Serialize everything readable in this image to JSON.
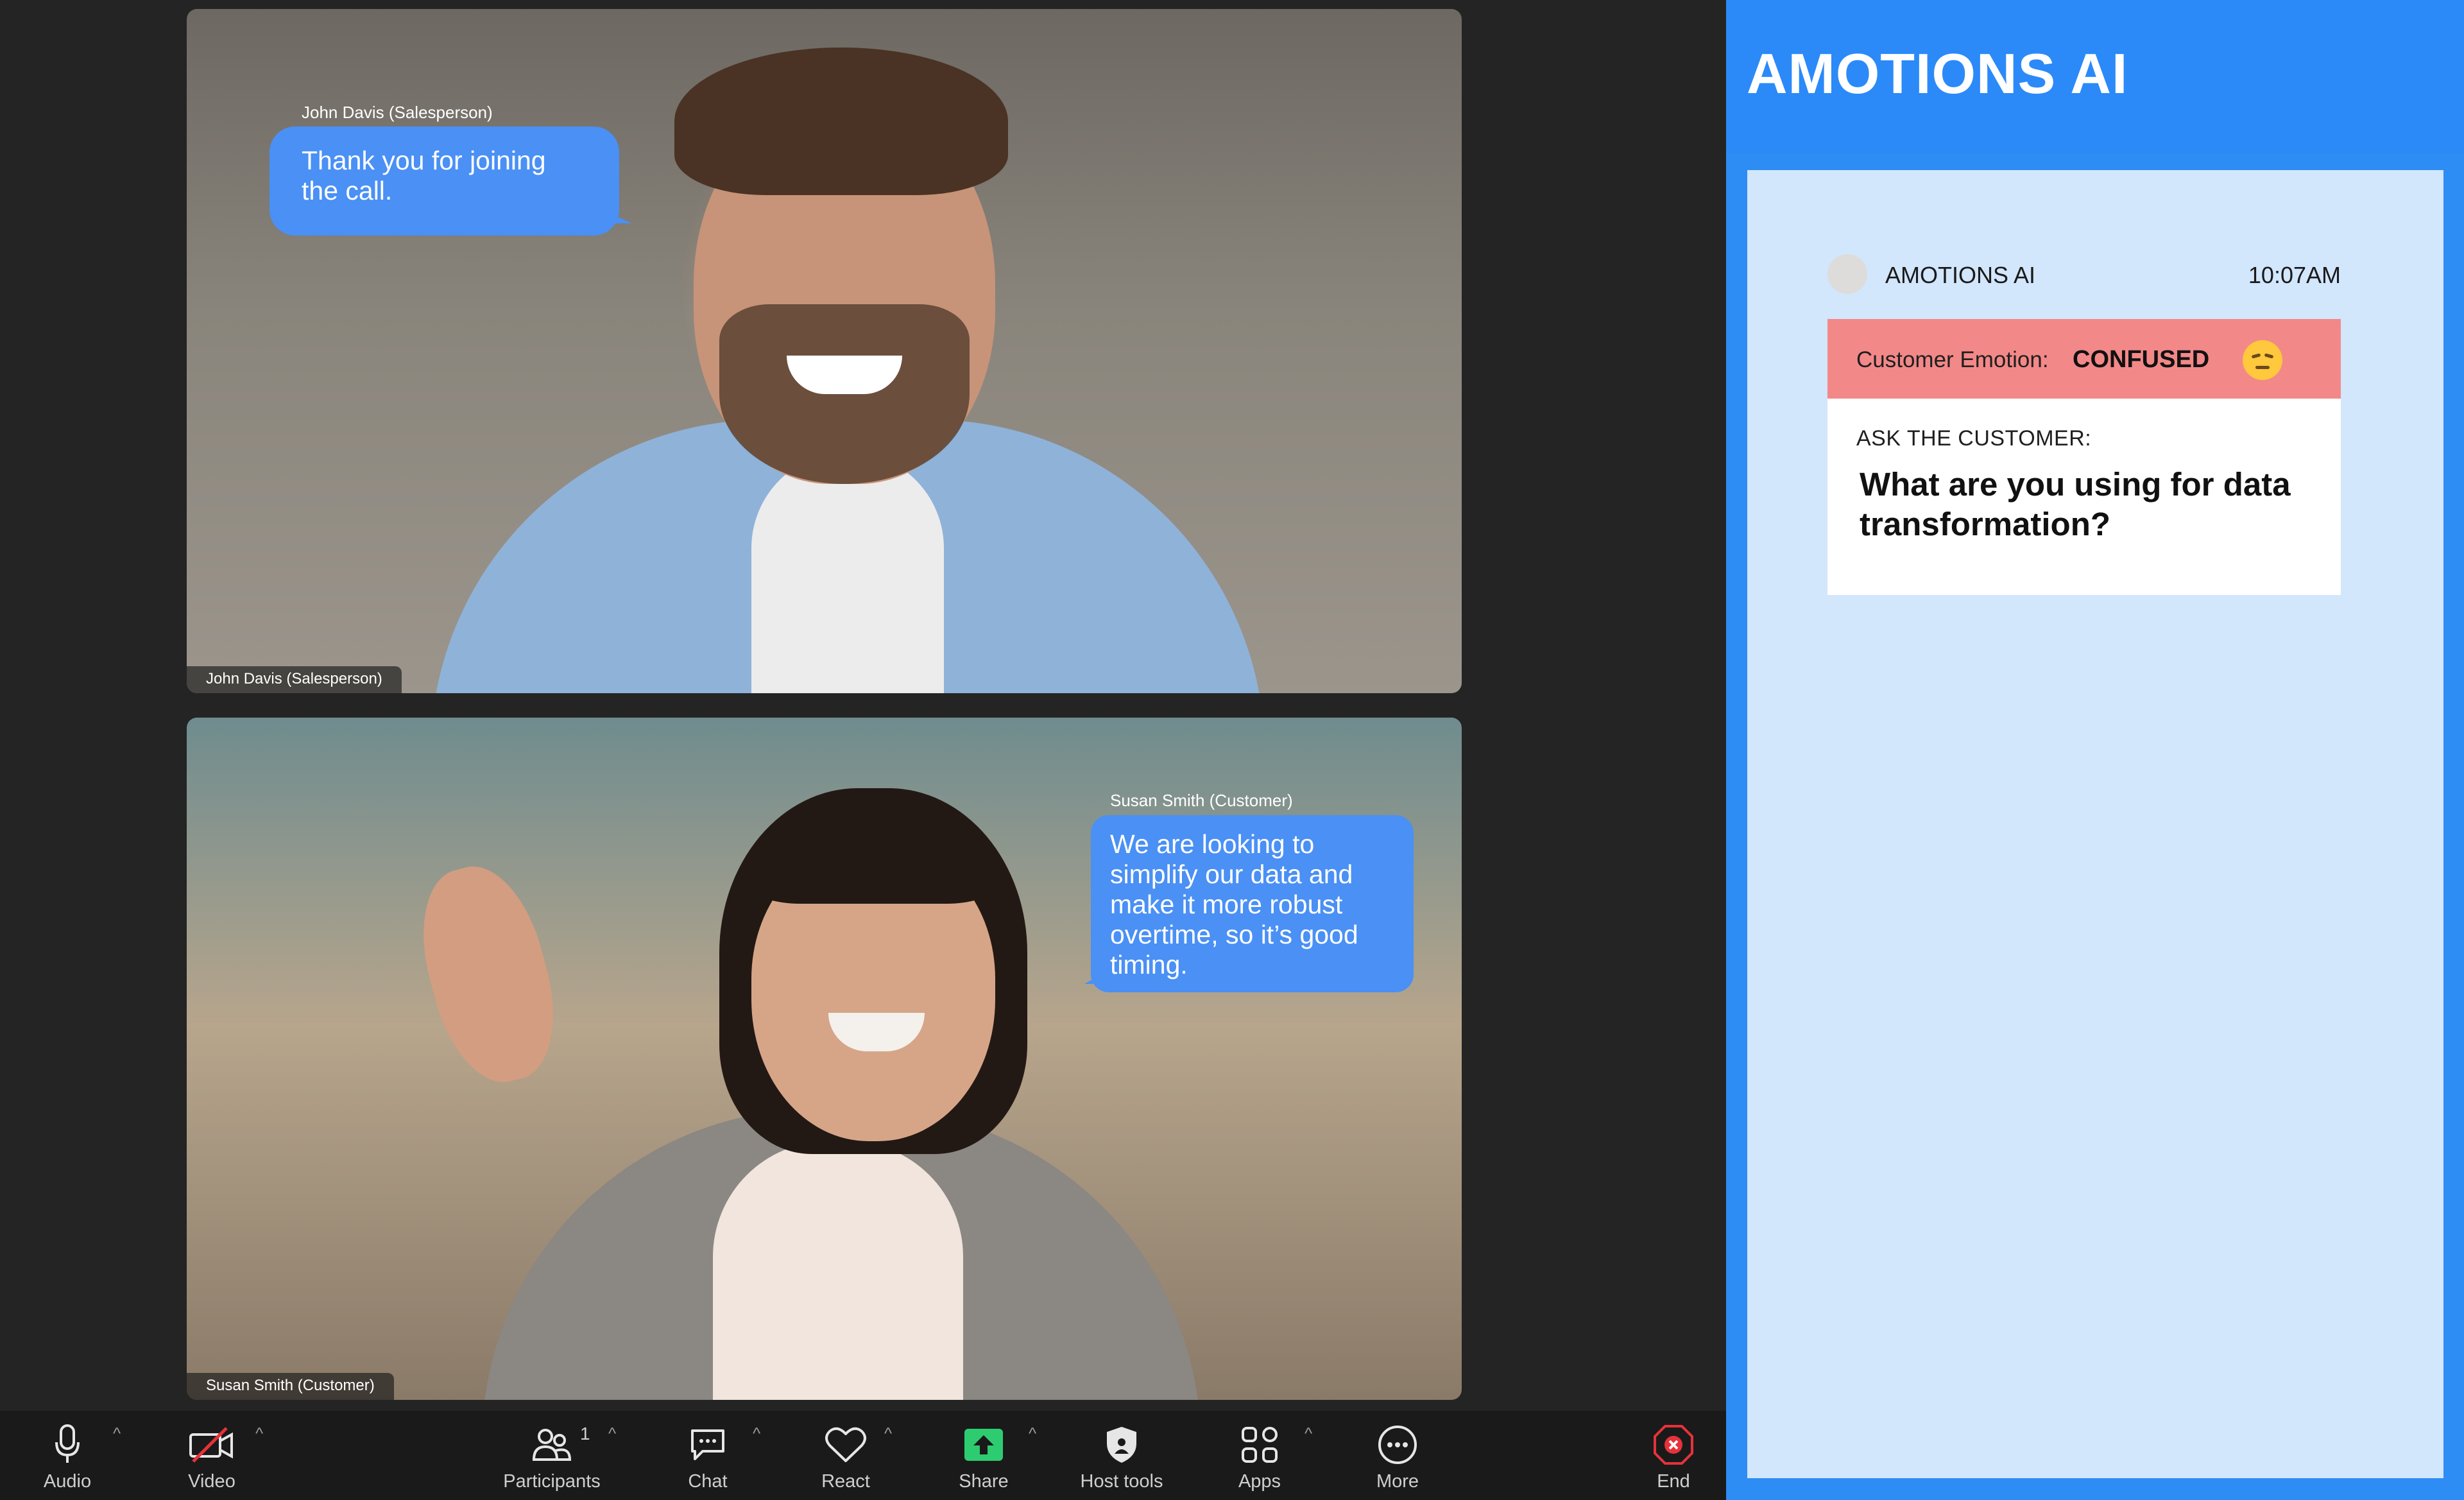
{
  "meeting": {
    "participants": [
      {
        "name_label": "John Davis (Salesperson)",
        "bubble_name": "John Davis (Salesperson)",
        "message": "Thank you for joining the call."
      },
      {
        "name_label": "Susan Smith (Customer)",
        "bubble_name": "Susan Smith (Customer)",
        "message": "We are looking to simplify our data and make it more robust overtime, so it’s good timing."
      }
    ]
  },
  "toolbar": {
    "audio": "Audio",
    "video": "Video",
    "participants": "Participants",
    "participants_count": "1",
    "chat": "Chat",
    "react": "React",
    "share": "Share",
    "host_tools": "Host tools",
    "apps": "Apps",
    "more": "More",
    "end": "End",
    "caret": "^",
    "icons": {
      "audio": "microphone-icon",
      "video": "camera-off-icon",
      "participants": "people-icon",
      "chat": "chat-bubble-icon",
      "react": "heart-icon",
      "share": "share-arrow-icon",
      "host_tools": "shield-icon",
      "apps": "apps-icon",
      "more": "more-dots-icon",
      "end": "end-call-icon"
    },
    "colors": {
      "share": "#2ecc71",
      "end": "#e5323b"
    }
  },
  "sidebar": {
    "brand": "AMOTIONS AI",
    "message": {
      "sender": "AMOTIONS AI",
      "time": "10:07AM",
      "emotion_label": "Customer Emotion:",
      "emotion_value": "CONFUSED",
      "ask_label": "ASK THE CUSTOMER:",
      "question": "What are you using for data transformation?"
    },
    "colors": {
      "header": "#2b8af8",
      "panel": "#d2e6fc",
      "emotion_bar": "#f38888"
    }
  }
}
